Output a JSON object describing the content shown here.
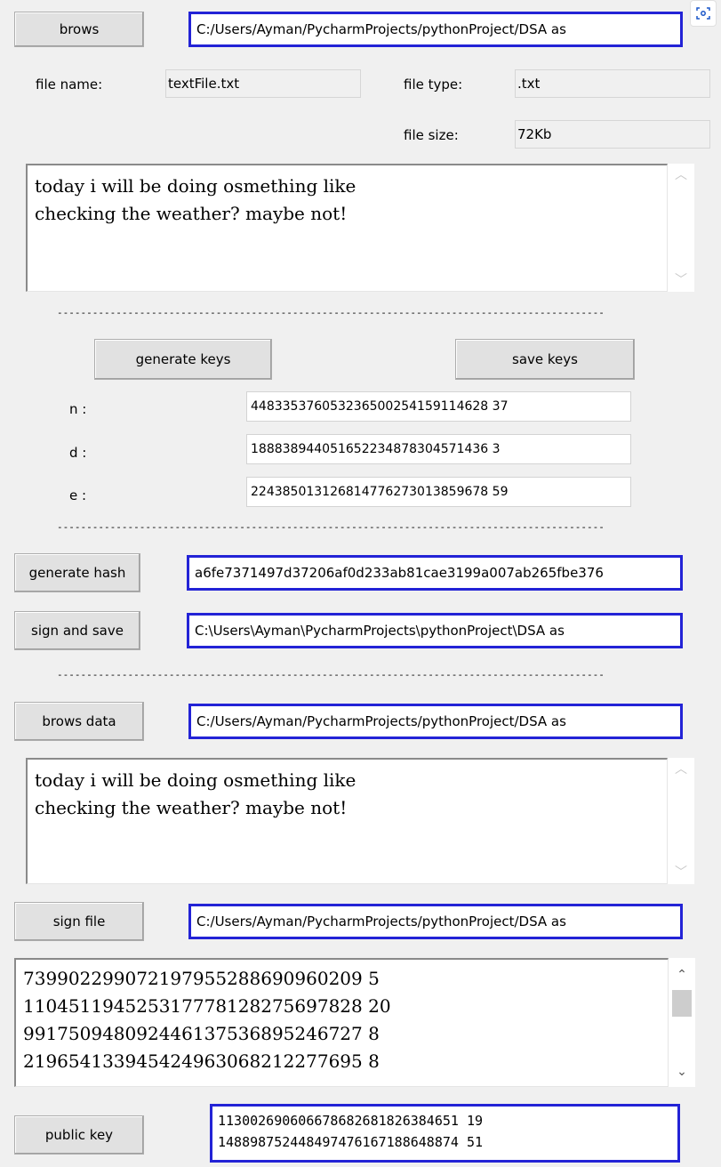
{
  "top": {
    "brows_label": "brows",
    "path": "C:/Users/Ayman/PycharmProjects/pythonProject/DSA as",
    "file_name_label": "file name:",
    "file_name_value": "textFile.txt",
    "file_type_label": "file type:",
    "file_type_value": ".txt",
    "file_size_label": "file size:",
    "file_size_value": "72Kb",
    "content_lines": [
      "today i will be doing osmething like",
      "checking the weather? maybe not!"
    ]
  },
  "separator": "---------------------------------------------------------------------------------------------",
  "keys": {
    "generate_label": "generate keys",
    "save_label": "save keys",
    "n_label": "n :",
    "n_value": "448335376053236500254159114628 37",
    "d_label": "d :",
    "d_value": "188838944051652234878304571436 3",
    "e_label": "e :",
    "e_value": "224385013126814776273013859678 59"
  },
  "hash": {
    "generate_label": "generate hash",
    "value": "a6fe7371497d37206af0d233ab81cae3199a007ab265fbe376"
  },
  "sign_save": {
    "label": "sign and save",
    "path": "C:\\Users\\Ayman\\PycharmProjects\\pythonProject\\DSA as"
  },
  "data": {
    "brows_label": "brows data",
    "path": "C:/Users/Ayman/PycharmProjects/pythonProject/DSA as",
    "content_lines": [
      "today i will be doing osmething like",
      "checking the weather? maybe not!"
    ]
  },
  "sign_file": {
    "label": "sign file",
    "path": "C:/Users/Ayman/PycharmProjects/pythonProject/DSA as",
    "signature_lines": [
      "739902299072197955288690960209 5",
      "110451194525317778128275697828 20",
      "991750948092446137536895246727 8",
      "219654133945424963068212277695 8"
    ]
  },
  "public_key": {
    "label": "public key",
    "lines": [
      "113002690606678682681826384651 19",
      "148898752448497476167188648874 51"
    ]
  },
  "icons": {
    "scroll_up": "▲",
    "scroll_down": "▼",
    "corner": "screenshot-icon"
  }
}
